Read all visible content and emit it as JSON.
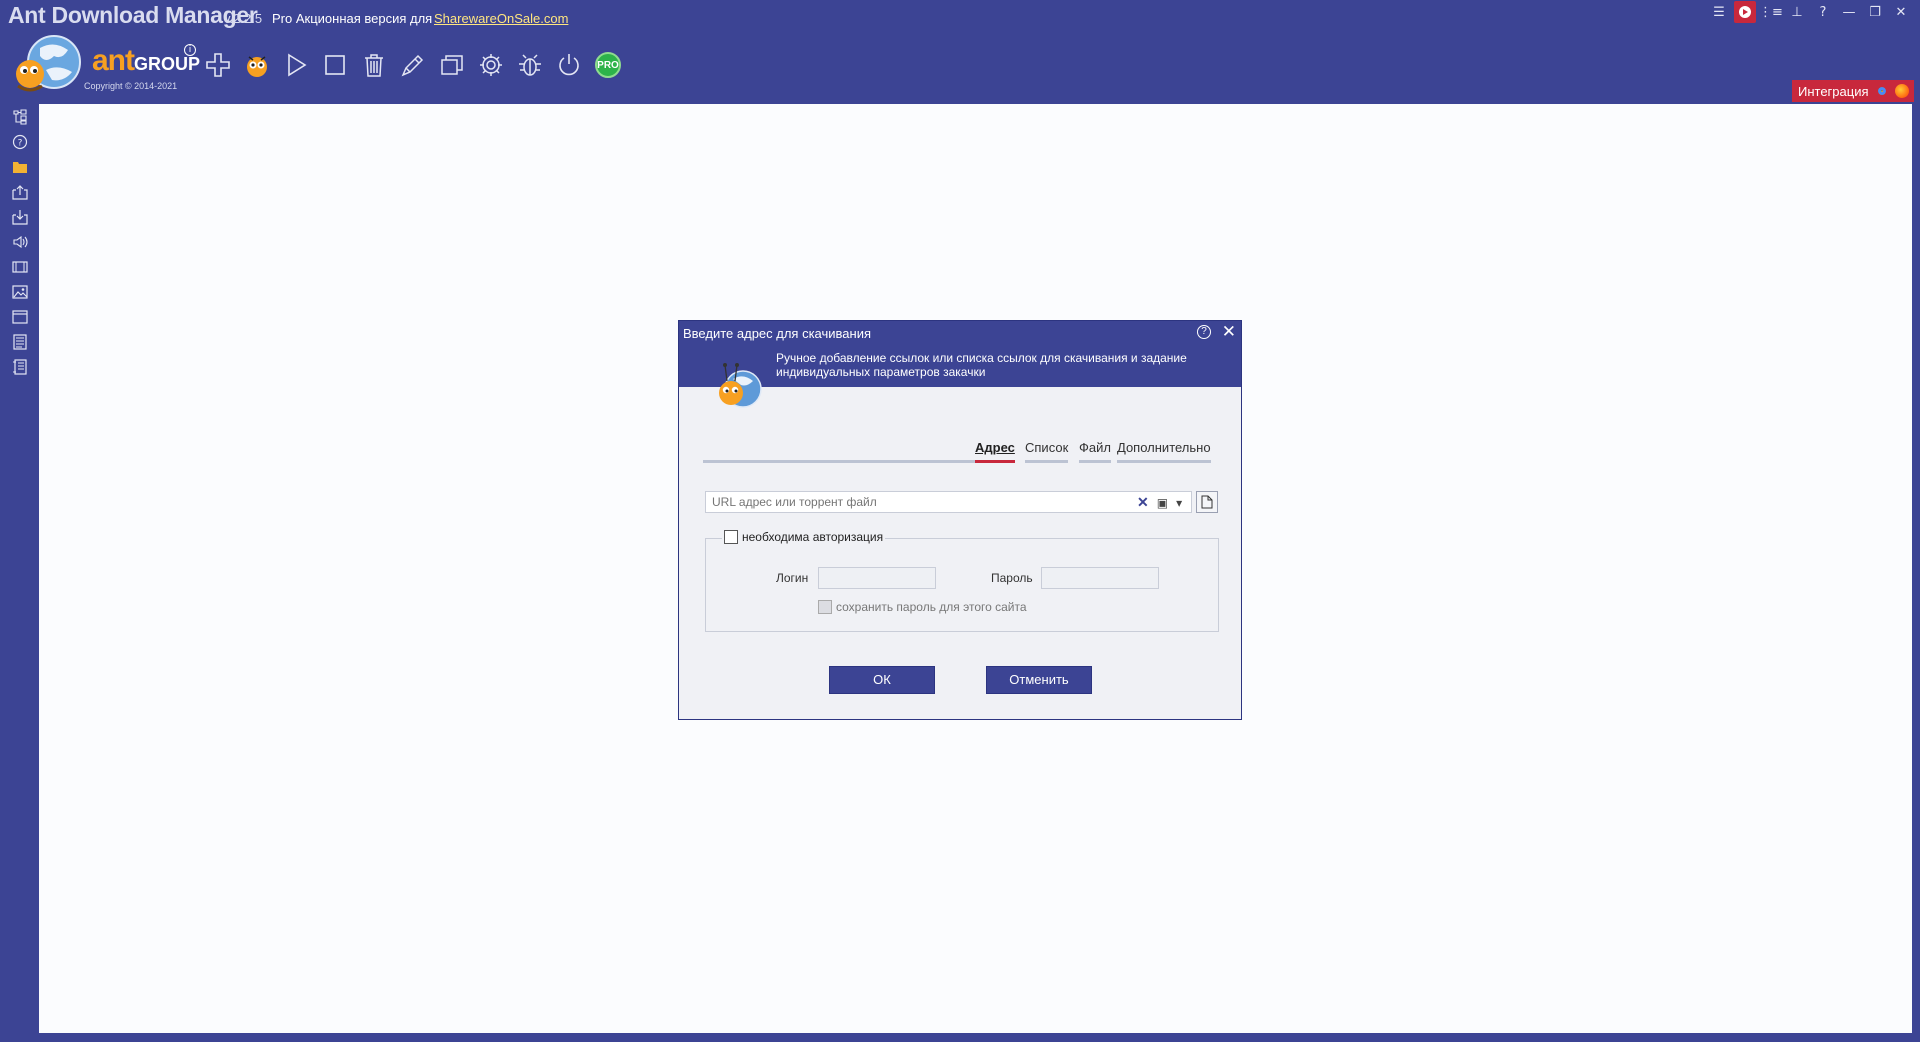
{
  "window": {
    "app_name": "Ant Download Manager",
    "version": "v.2.2.5",
    "promo": "Pro Акционная версия для",
    "promo_link": "SharewareOnSale.com",
    "copyright": "Copyright © 2014-2021"
  },
  "brand": {
    "main": "ant",
    "group": "GROUP"
  },
  "toolbar": {
    "items": [
      "add-icon",
      "ant-mascot-icon",
      "play-icon",
      "stop-icon",
      "trash-icon",
      "pen-icon",
      "windows-icon",
      "gear-icon",
      "bug-icon",
      "power-icon",
      "pro-icon"
    ],
    "pro_label": "PRO"
  },
  "integration": {
    "label": "Интеграция"
  },
  "sidebar": {
    "items": [
      "tree-icon",
      "help-icon",
      "folder-icon",
      "upload-icon",
      "download-icon",
      "audio-icon",
      "video-icon",
      "image-icon",
      "window-icon",
      "document-icon",
      "archive-icon"
    ]
  },
  "dialog": {
    "title": "Введите адрес для скачивания",
    "description": "Ручное добавление ссылок или списка ссылок для скачивания и задание индивидуальных параметров закачки",
    "tabs": [
      {
        "label": "Адрес",
        "active": true
      },
      {
        "label": "Список",
        "active": false
      },
      {
        "label": "Файл",
        "active": false
      },
      {
        "label": "Дополнительно",
        "active": false
      }
    ],
    "url_placeholder": "URL адрес или торрент файл",
    "url_value": "",
    "auth": {
      "checkbox_label": "необходима авторизация",
      "checked": false,
      "login_label": "Логин",
      "login_value": "",
      "password_label": "Пароль",
      "password_value": "",
      "save_label": "сохранить пароль для этого сайта"
    },
    "ok_label": "ОК",
    "cancel_label": "Отменить"
  },
  "colors": {
    "primary": "#3c4494",
    "accent": "#c8283c",
    "content_bg": "#fbfcfe",
    "brand_orange": "#f7a021"
  }
}
